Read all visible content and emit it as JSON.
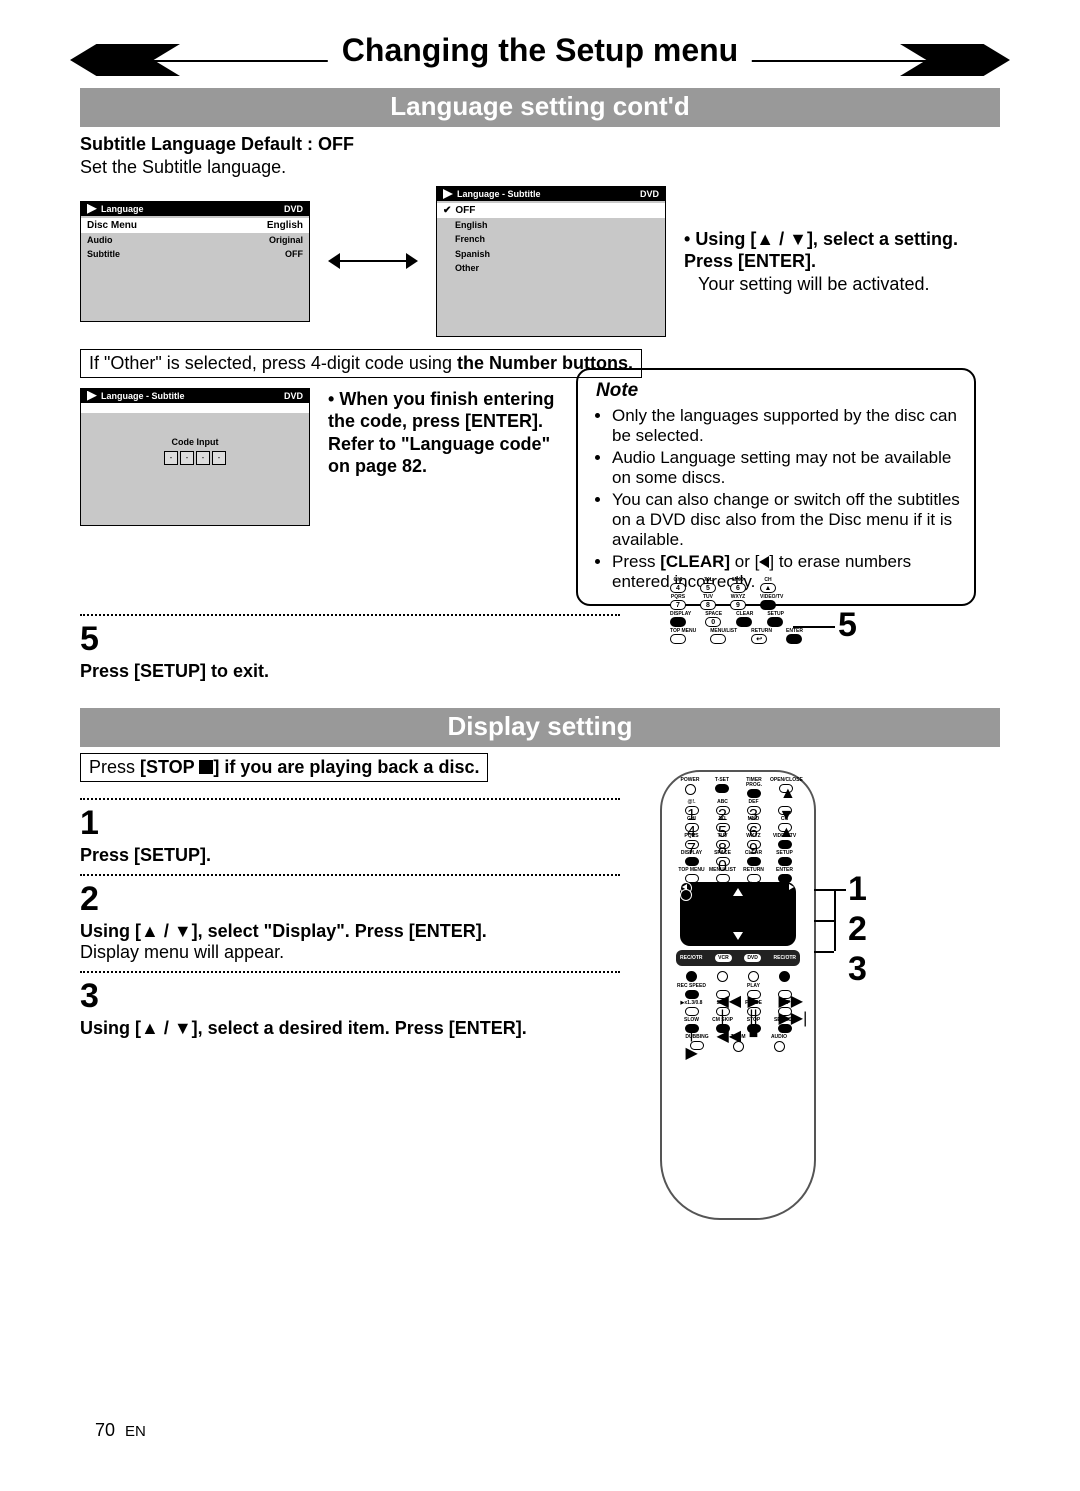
{
  "banner_title": "Changing the Setup menu",
  "section1_title": "Language setting cont'd",
  "subtitle_heading": "Subtitle Language Default : OFF",
  "subtitle_desc": "Set the Subtitle language.",
  "osd1": {
    "header_title": "Language",
    "header_tag": "DVD",
    "rows": [
      {
        "label": "Disc Menu",
        "value": "English",
        "hl": true
      },
      {
        "label": "Audio",
        "value": "Original",
        "hl": false
      },
      {
        "label": "Subtitle",
        "value": "OFF",
        "hl": false
      }
    ]
  },
  "osd2": {
    "header_title": "Language - Subtitle",
    "header_tag": "DVD",
    "hl": "OFF",
    "items": [
      "English",
      "French",
      "Spanish",
      "Other"
    ]
  },
  "using_text": "Using [▲ / ▼], select a setting. Press [ENTER].",
  "using_sub": "Your setting will be activated.",
  "other_note_prefix": "If \"Other\" is selected, press 4-digit code using ",
  "other_note_bold": "the Number buttons.",
  "code_osd": {
    "header_title": "Language - Subtitle",
    "header_tag": "DVD",
    "label": "Code Input"
  },
  "code_instr": "When you finish entering the code, press [ENTER]. Refer to \"Language code\" on page 82.",
  "note_title": "Note",
  "notes": {
    "n1": "Only the languages supported by the disc can be selected.",
    "n2": "Audio Language setting may not be available on some discs.",
    "n3": "You can also change or switch off the subtitles on a DVD disc also from the Disc menu if it is available.",
    "n4_pre": "Press ",
    "n4_b1": "[CLEAR]",
    "n4_mid": " or [",
    "n4_post": "] to erase numbers entered incorrectly."
  },
  "step5_num": "5",
  "step5_text": "Press [SETUP] to exit.",
  "callout5": "5",
  "section2_title": "Display setting",
  "stop_note_pre": "Press ",
  "stop_note_b": "[STOP ",
  "stop_note_post": "] if you are playing back a disc.",
  "step1_num": "1",
  "step1_text": "Press [SETUP].",
  "step2_num": "2",
  "step2_text": "Using [▲ / ▼], select \"Display\". Press [ENTER].",
  "step2_sub": "Display menu will appear.",
  "step3_num": "3",
  "step3_text": "Using [▲ / ▼], select a desired item. Press [ENTER].",
  "callout1": "1",
  "callout2": "2",
  "callout3": "3",
  "page_num": "70",
  "page_lang": "EN",
  "keypad": {
    "r1": [
      "GHI",
      "JKL",
      "MNO",
      "CH"
    ],
    "r1n": [
      "4",
      "5",
      "6",
      "▲"
    ],
    "r2": [
      "PQRS",
      "TUV",
      "WXYZ",
      "VIDEO/TV"
    ],
    "r2n": [
      "7",
      "8",
      "9",
      ""
    ],
    "r3": [
      "DISPLAY",
      "SPACE",
      "CLEAR",
      "SETUP"
    ],
    "r3n": [
      "",
      "0",
      "",
      ""
    ],
    "r4": [
      "TOP MENU",
      "MENU/LIST",
      "RETURN",
      "ENTER"
    ]
  }
}
